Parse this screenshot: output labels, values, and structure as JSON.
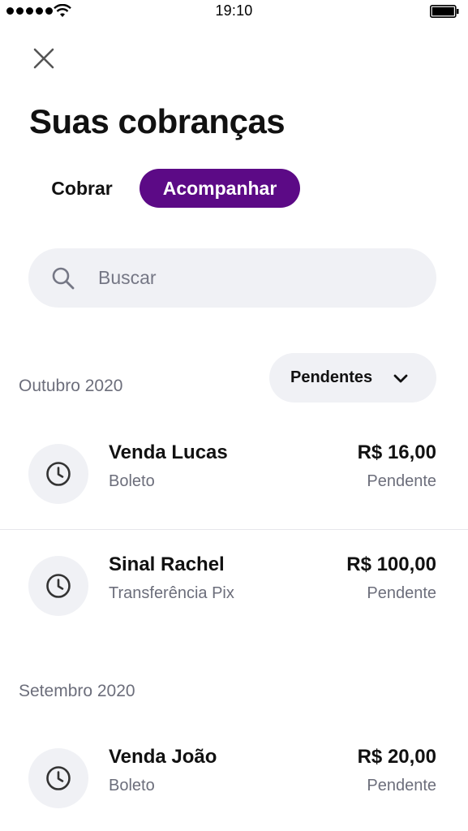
{
  "status_bar": {
    "time": "19:10",
    "icons": [
      "signal-dots-icon",
      "wifi-icon",
      "battery-icon"
    ]
  },
  "header": {
    "close_icon": "close-icon",
    "title": "Suas cobranças"
  },
  "tabs": [
    {
      "label": "Cobrar",
      "active": false
    },
    {
      "label": "Acompanhar",
      "active": true
    }
  ],
  "search": {
    "placeholder": "Buscar",
    "value": "",
    "icon": "search-icon"
  },
  "filter": {
    "selected": "Pendentes",
    "icon": "chevron-down-icon"
  },
  "sections": [
    {
      "heading": "Outubro 2020",
      "items": [
        {
          "title": "Venda Lucas",
          "method": "Boleto",
          "amount": "R$ 16,00",
          "status": "Pendente",
          "icon": "clock-icon"
        },
        {
          "title": "Sinal Rachel",
          "method": "Transferência Pix",
          "amount": "R$ 100,00",
          "status": "Pendente",
          "icon": "clock-icon"
        }
      ]
    },
    {
      "heading": "Setembro 2020",
      "items": [
        {
          "title": "Venda João",
          "method": "Boleto",
          "amount": "R$ 20,00",
          "status": "Pendente",
          "icon": "clock-icon"
        }
      ]
    }
  ],
  "colors": {
    "accent": "#5c0a86",
    "surface": "#f0f1f5",
    "muted_text": "#6c6e7b",
    "primary_text": "#111111"
  }
}
